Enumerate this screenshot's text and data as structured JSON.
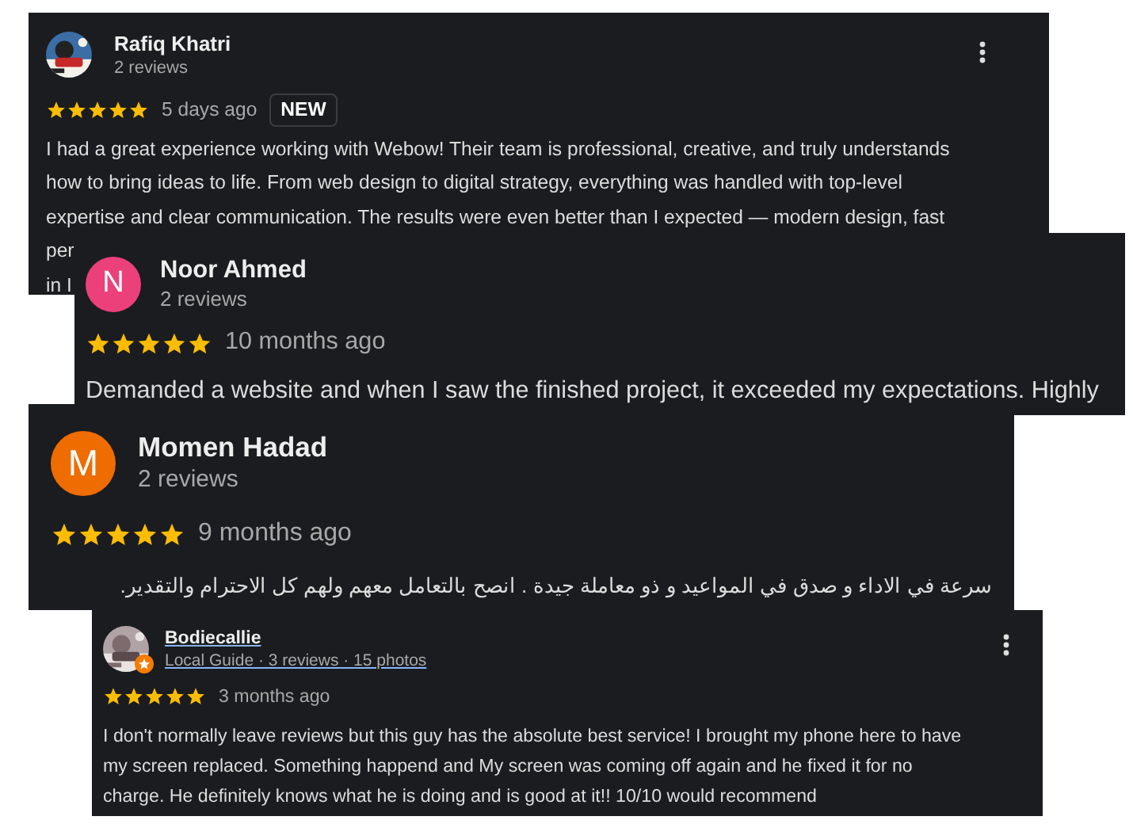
{
  "reviews": [
    {
      "name": "Rafiq Khatri",
      "meta": "2 reviews",
      "avatar": {
        "kind": "picture"
      },
      "stars": 5,
      "time": "5 days ago",
      "badge": "NEW",
      "menu": true,
      "lines": [
        "I had a great experience working with Webow! Their team is professional, creative, and truly understands",
        "how to bring ideas to life. From web design to digital strategy, everything was handled with top-level",
        "expertise and clear communication. The results were even better than I expected — modern design, fast"
      ],
      "covered_lines": [
        "per",
        "in I"
      ]
    },
    {
      "name": "Noor Ahmed",
      "meta": "2 reviews",
      "avatar": {
        "kind": "letter",
        "letter": "N",
        "color": "#ec407a"
      },
      "stars": 5,
      "time": "10 months ago",
      "lines": [
        "Demanded a website and when I saw the finished project, it exceeded my expectations. Highly"
      ]
    },
    {
      "name": "Momen Hadad",
      "meta": "2 reviews",
      "avatar": {
        "kind": "letter",
        "letter": "M",
        "color": "#ef6c00"
      },
      "stars": 5,
      "time": "9 months ago",
      "lines": [
        "سرعة في الاداء و صدق في المواعيد و ذو معاملة جيدة . انصح بالتعامل معهم ولهم كل الاحترام والتقدير."
      ]
    },
    {
      "name": "Bodiecallie",
      "name_link": true,
      "meta": "Local Guide · 3 reviews · 15 photos",
      "meta_link": true,
      "avatar": {
        "kind": "picture"
      },
      "local_guide": true,
      "stars": 5,
      "time": "3 months ago",
      "menu": true,
      "lines": [
        "I don't normally leave reviews but this guy has the absolute best service! I brought my phone here to have",
        "my screen replaced. Something happend and My screen was coming off again and he fixed it for no",
        "charge. He definitely knows what he is doing and is good at it!! 10/10 would recommend"
      ]
    }
  ]
}
